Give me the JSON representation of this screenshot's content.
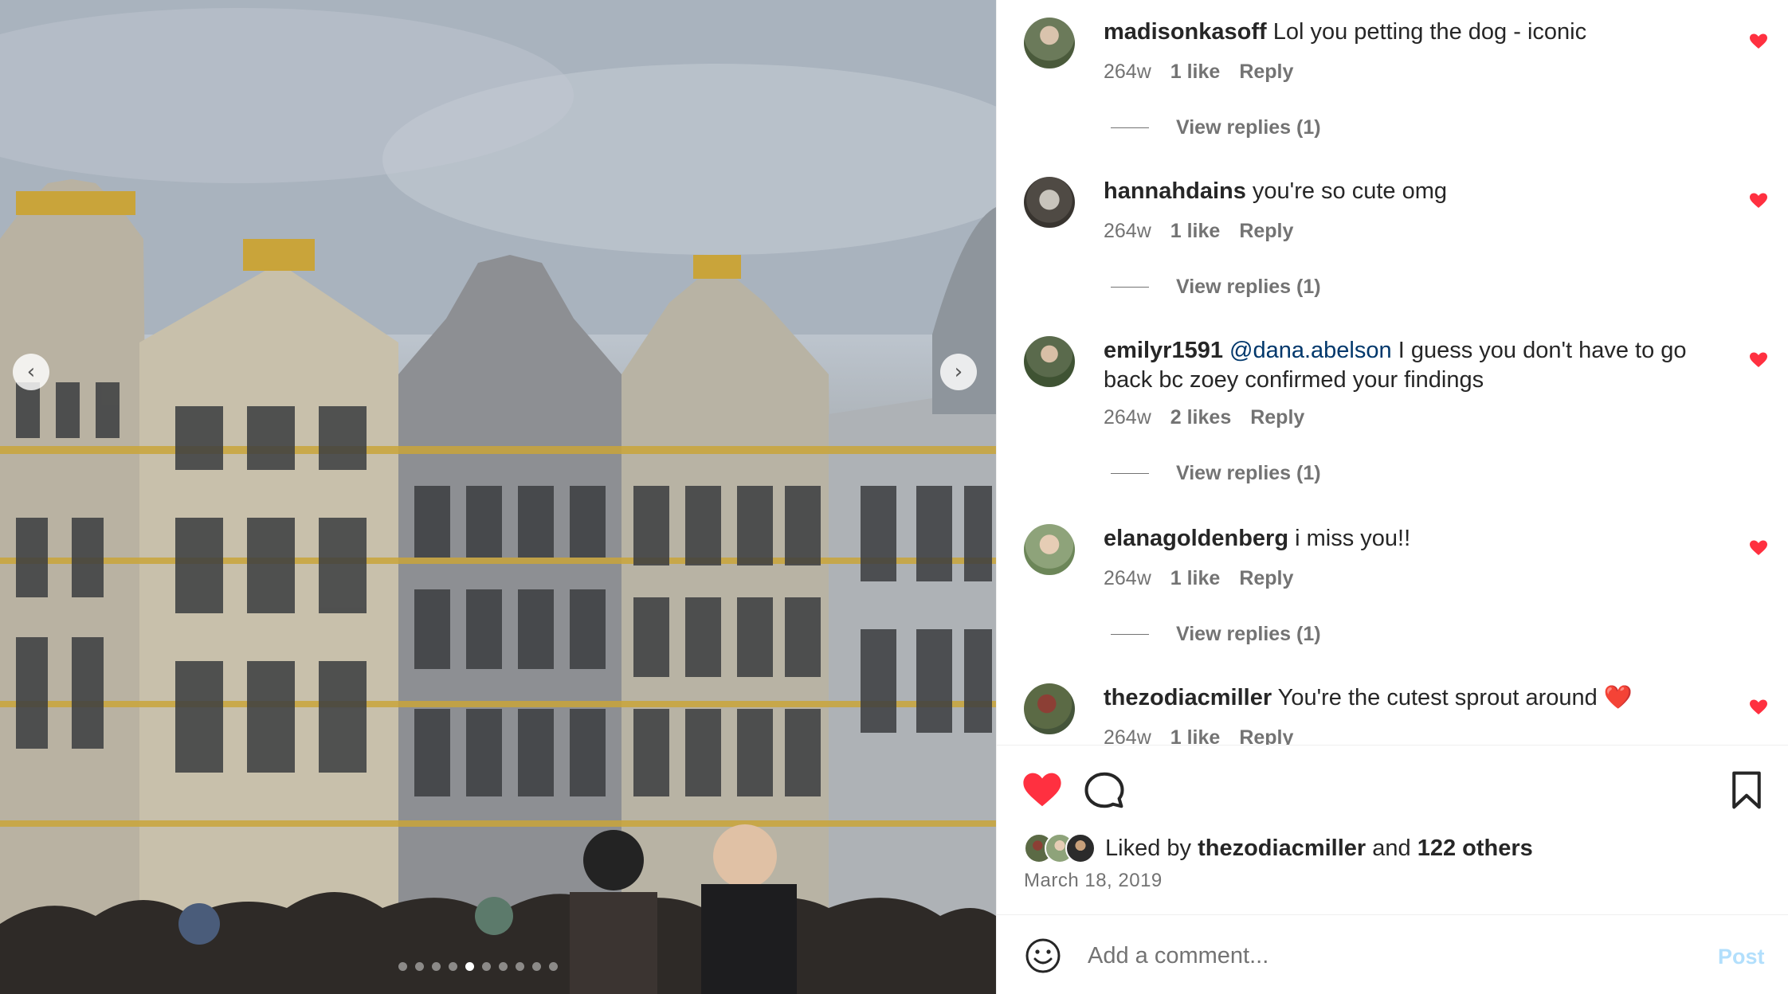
{
  "photo": {
    "prev_icon": "chevron-left-icon",
    "next_icon": "chevron-right-icon",
    "prev_glyph": "‹",
    "next_glyph": "›",
    "dots_total": 10,
    "dots_active_index": 4
  },
  "comments": [
    {
      "username": "madisonkasoff",
      "mention": "",
      "text": "Lol you petting the dog - iconic",
      "time": "264w",
      "likes": "1 like",
      "reply_label": "Reply",
      "view_replies": "View replies (1)",
      "liked": true
    },
    {
      "username": "hannahdains",
      "mention": "",
      "text": "you're so cute omg",
      "time": "264w",
      "likes": "1 like",
      "reply_label": "Reply",
      "view_replies": "View replies (1)",
      "liked": true
    },
    {
      "username": "emilyr1591",
      "mention": "@dana.abelson",
      "text": "I guess you don't have to go back bc zoey confirmed your findings",
      "time": "264w",
      "likes": "2 likes",
      "reply_label": "Reply",
      "view_replies": "View replies (1)",
      "liked": true
    },
    {
      "username": "elanagoldenberg",
      "mention": "",
      "text": "i miss you!!",
      "time": "264w",
      "likes": "1 like",
      "reply_label": "Reply",
      "view_replies": "View replies (1)",
      "liked": true
    },
    {
      "username": "thezodiacmiller",
      "mention": "",
      "text": "You're the cutest sprout around ❤️",
      "time": "264w",
      "likes": "1 like",
      "reply_label": "Reply",
      "view_replies": "",
      "liked": true
    }
  ],
  "actions": {
    "like_icon": "heart-filled-icon",
    "comment_icon": "comment-bubble-icon",
    "save_icon": "bookmark-icon",
    "liked": true
  },
  "likes": {
    "prefix": "Liked by",
    "user": "thezodiacmiller",
    "conjunction": "and",
    "others": "122 others"
  },
  "date": "March 18, 2019",
  "add_comment": {
    "emoji_icon": "emoji-smile-icon",
    "placeholder": "Add a comment...",
    "post_label": "Post"
  },
  "colors": {
    "heart_red": "#ff3040",
    "text_primary": "#262626",
    "text_secondary": "#737373",
    "mention_blue": "#00376b",
    "post_disabled": "#b2dffc"
  }
}
